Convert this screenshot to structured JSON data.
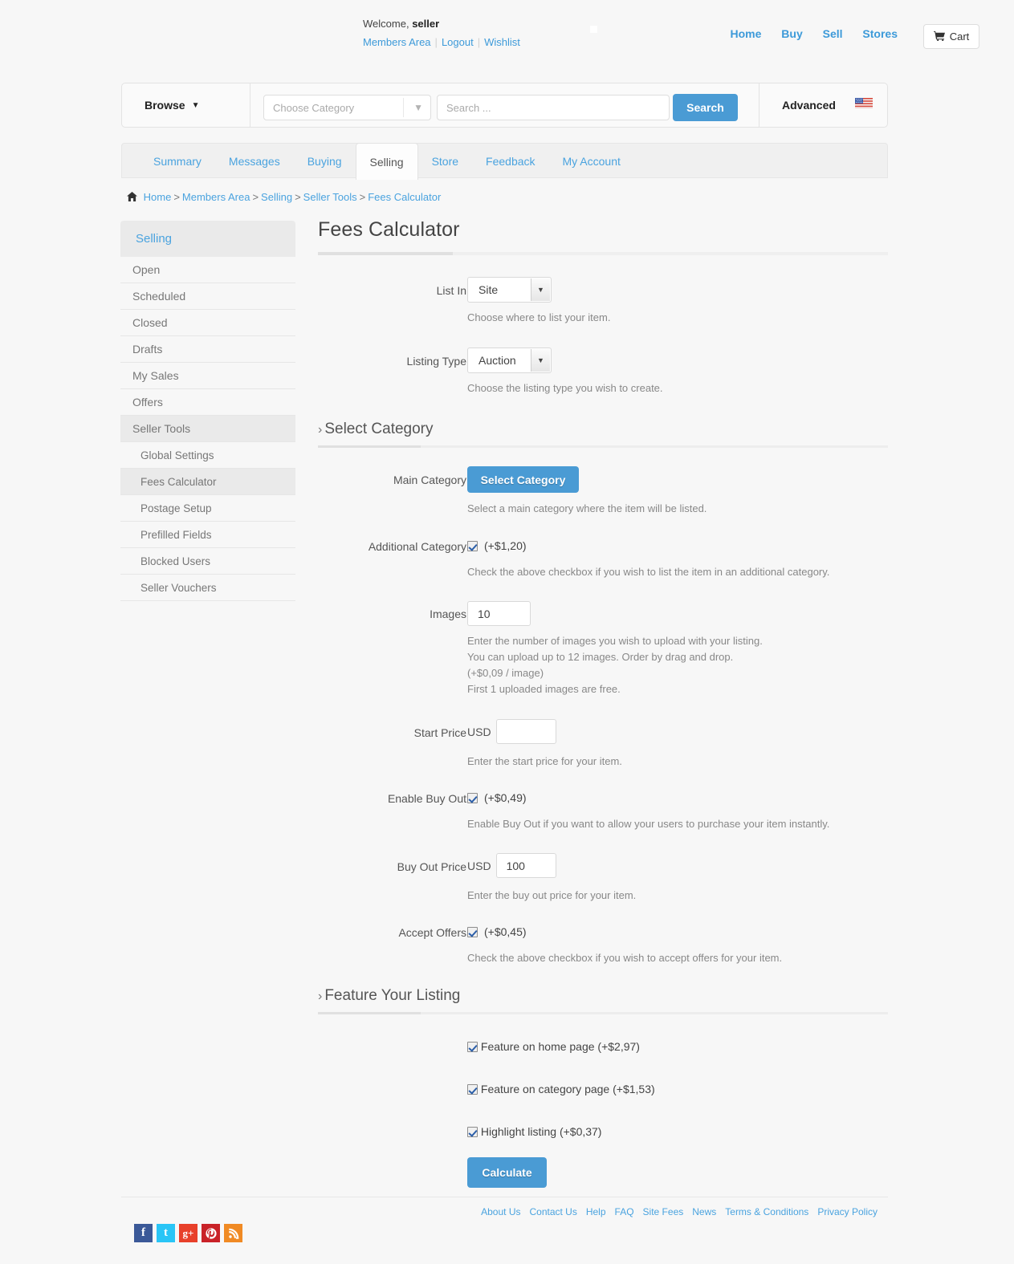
{
  "header": {
    "welcome_prefix": "Welcome,",
    "username": "seller",
    "links": [
      {
        "label": "Members Area"
      },
      {
        "label": "Logout"
      },
      {
        "label": "Wishlist"
      }
    ],
    "nav": [
      {
        "label": "Home"
      },
      {
        "label": "Buy"
      },
      {
        "label": "Sell"
      },
      {
        "label": "Stores"
      }
    ],
    "cart_label": "Cart",
    "cart_icon": "shopping-cart-icon"
  },
  "search": {
    "browse_label": "Browse",
    "browse_caret": "▼",
    "category_placeholder": "Choose Category",
    "category_caret": "▼",
    "search_placeholder": "Search ...",
    "search_button": "Search",
    "advanced_label": "Advanced",
    "flag_icon": "us-flag-icon"
  },
  "tabs": [
    {
      "label": "Summary",
      "active": false
    },
    {
      "label": "Messages",
      "active": false
    },
    {
      "label": "Buying",
      "active": false
    },
    {
      "label": "Selling",
      "active": true
    },
    {
      "label": "Store",
      "active": false
    },
    {
      "label": "Feedback",
      "active": false
    },
    {
      "label": "My Account",
      "active": false
    }
  ],
  "breadcrumb": {
    "home_icon": "home-icon",
    "items": [
      "Home",
      "Members Area",
      "Selling",
      "Seller Tools",
      "Fees Calculator"
    ],
    "separator": ">"
  },
  "sidebar": {
    "heading": "Selling",
    "items": [
      {
        "label": "Open",
        "sub": false,
        "selected": false
      },
      {
        "label": "Scheduled",
        "sub": false,
        "selected": false
      },
      {
        "label": "Closed",
        "sub": false,
        "selected": false
      },
      {
        "label": "Drafts",
        "sub": false,
        "selected": false
      },
      {
        "label": "My Sales",
        "sub": false,
        "selected": false
      },
      {
        "label": "Offers",
        "sub": false,
        "selected": false
      },
      {
        "label": "Seller Tools",
        "sub": false,
        "selected": true
      },
      {
        "label": "Global Settings",
        "sub": true,
        "selected": false
      },
      {
        "label": "Fees Calculator",
        "sub": true,
        "selected": true
      },
      {
        "label": "Postage Setup",
        "sub": true,
        "selected": false
      },
      {
        "label": "Prefilled Fields",
        "sub": true,
        "selected": false
      },
      {
        "label": "Blocked Users",
        "sub": true,
        "selected": false
      },
      {
        "label": "Seller Vouchers",
        "sub": true,
        "selected": false
      }
    ]
  },
  "main": {
    "title": "Fees Calculator",
    "list_in": {
      "label": "List In",
      "value": "Site",
      "help": "Choose where to list your item."
    },
    "listing_type": {
      "label": "Listing Type",
      "value": "Auction",
      "help": "Choose the listing type you wish to create."
    },
    "select_category_section": {
      "heading": "Select Category",
      "chevron": "›"
    },
    "main_category": {
      "label": "Main Category",
      "button": "Select Category",
      "help": "Select a main category where the item will be listed."
    },
    "additional_category": {
      "label": "Additional Category",
      "amount": "(+$1,20)",
      "help": "Check the above checkbox if you wish to list the item in an additional category."
    },
    "images": {
      "label": "Images",
      "value": "10",
      "help1": "Enter the number of images you wish to upload with your listing.",
      "help2": "You can upload up to 12 images. Order by drag and drop.",
      "help3": "(+$0,09 / image)",
      "help4": "First 1 uploaded images are free."
    },
    "start_price": {
      "label": "Start Price",
      "currency": "USD",
      "value": "",
      "help": "Enter the start price for your item."
    },
    "enable_buy_out": {
      "label": "Enable Buy Out",
      "amount": "(+$0,49)",
      "help": "Enable Buy Out if you want to allow your users to purchase your item instantly."
    },
    "buy_out_price": {
      "label": "Buy Out Price",
      "currency": "USD",
      "value": "100",
      "help": "Enter the buy out price for your item."
    },
    "accept_offers": {
      "label": "Accept Offers",
      "amount": "(+$0,45)",
      "help": "Check the above checkbox if you wish to accept offers for your item."
    },
    "feature_section": {
      "heading": "Feature Your Listing",
      "chevron": "›"
    },
    "feature_options": [
      {
        "label": "Feature on home page (+$2,97)"
      },
      {
        "label": "Feature on category page (+$1,53)"
      },
      {
        "label": "Highlight listing (+$0,37)"
      }
    ],
    "calculate_button": "Calculate"
  },
  "footer": {
    "links": [
      {
        "label": "About Us"
      },
      {
        "label": "Contact Us"
      },
      {
        "label": "Help"
      },
      {
        "label": "FAQ"
      },
      {
        "label": "Site Fees"
      },
      {
        "label": "News"
      },
      {
        "label": "Terms & Conditions"
      },
      {
        "label": "Privacy Policy"
      }
    ],
    "social": [
      {
        "name": "facebook-icon",
        "glyph": "f",
        "color": "#3b5998"
      },
      {
        "name": "twitter-icon",
        "glyph": "t",
        "color": "#29c5f6"
      },
      {
        "name": "googleplus-icon",
        "glyph": "g+",
        "color": "#e8402a"
      },
      {
        "name": "pinterest-icon",
        "glyph": "p",
        "color": "#c92228"
      },
      {
        "name": "rss-icon",
        "glyph": "⌘",
        "color": "#f08a24"
      }
    ]
  },
  "colors": {
    "accent_blue": "#4a9bd4",
    "link_blue": "#4aa3df",
    "page_bg": "#f7f7f7"
  }
}
